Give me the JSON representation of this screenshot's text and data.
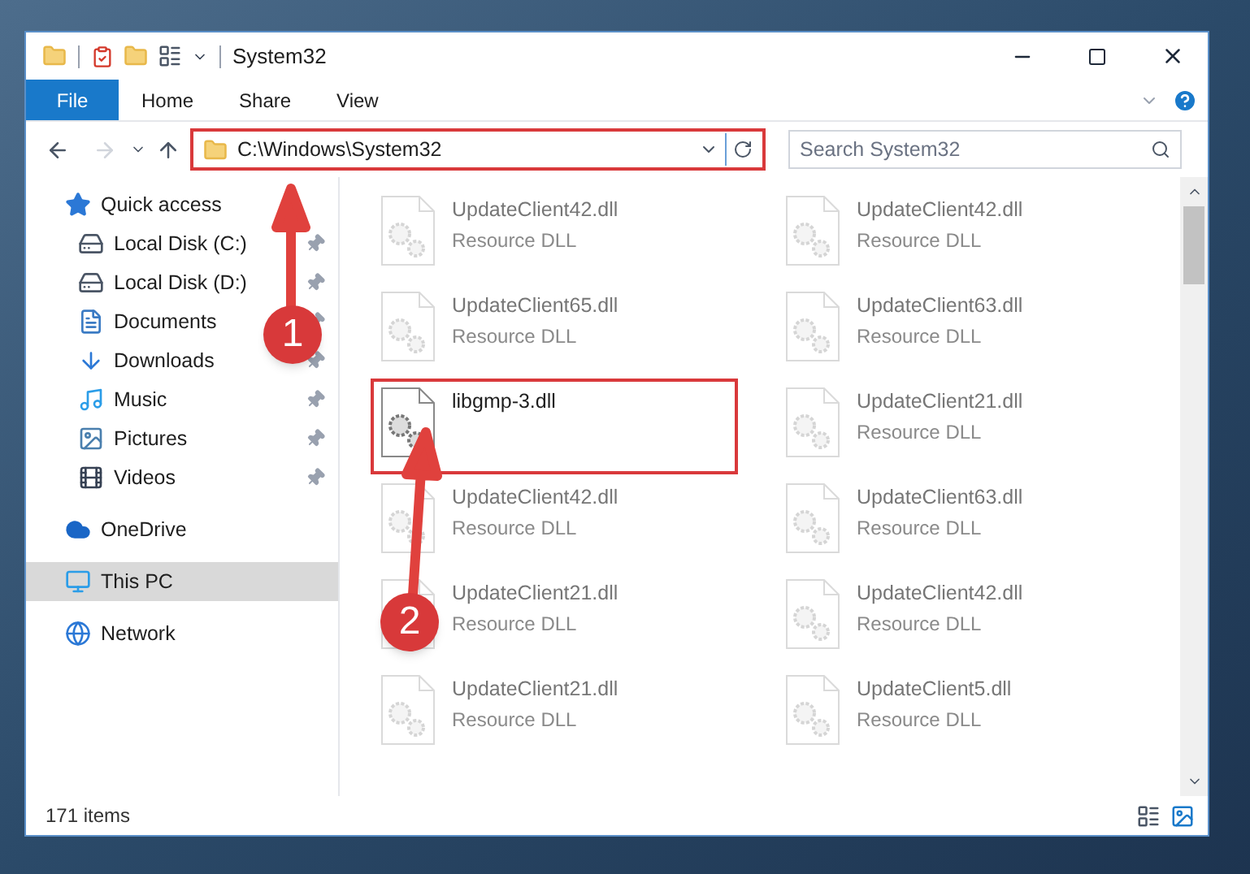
{
  "window": {
    "title": "System32"
  },
  "ribbon_tabs": [
    {
      "label": "File",
      "selected": true
    },
    {
      "label": "Home",
      "selected": false
    },
    {
      "label": "Share",
      "selected": false
    },
    {
      "label": "View",
      "selected": false
    }
  ],
  "address": {
    "path": "C:\\Windows\\System32",
    "highlighted": true
  },
  "search": {
    "placeholder": "Search System32"
  },
  "sidebar": {
    "items": [
      {
        "label": "Quick access",
        "kind": "star",
        "selected": false,
        "children": [
          {
            "label": "Local Disk (C:)",
            "kind": "drive",
            "pinned": true,
            "selected": false
          },
          {
            "label": "Local Disk (D:)",
            "kind": "drive",
            "pinned": true,
            "selected": false
          },
          {
            "label": "Documents",
            "kind": "documents",
            "pinned": true,
            "selected": false
          },
          {
            "label": "Downloads",
            "kind": "downloads",
            "pinned": true,
            "selected": false
          },
          {
            "label": "Music",
            "kind": "music",
            "pinned": true,
            "selected": false
          },
          {
            "label": "Pictures",
            "kind": "pictures",
            "pinned": true,
            "selected": false
          },
          {
            "label": "Videos",
            "kind": "videos",
            "pinned": true,
            "selected": false
          }
        ]
      },
      {
        "label": "OneDrive",
        "kind": "cloud",
        "selected": false
      },
      {
        "label": "This PC",
        "kind": "computer",
        "selected": true
      },
      {
        "label": "Network",
        "kind": "network",
        "selected": false
      }
    ]
  },
  "files": [
    {
      "name": "UpdateClient42.dll",
      "type": "Resource DLL",
      "blurred": true,
      "highlighted": false
    },
    {
      "name": "UpdateClient42.dll",
      "type": "Resource DLL",
      "blurred": true,
      "highlighted": false
    },
    {
      "name": "UpdateClient65.dll",
      "type": "Resource DLL",
      "blurred": true,
      "highlighted": false
    },
    {
      "name": "UpdateClient63.dll",
      "type": "Resource DLL",
      "blurred": true,
      "highlighted": false
    },
    {
      "name": "libgmp-3.dll",
      "blurred": false,
      "highlighted": true
    },
    {
      "name": "UpdateClient21.dll",
      "type": "Resource DLL",
      "blurred": true,
      "highlighted": false
    },
    {
      "name": "UpdateClient42.dll",
      "type": "Resource DLL",
      "blurred": true,
      "highlighted": false
    },
    {
      "name": "UpdateClient63.dll",
      "type": "Resource DLL",
      "blurred": true,
      "highlighted": false
    },
    {
      "name": "UpdateClient21.dll",
      "type": "Resource DLL",
      "blurred": true,
      "highlighted": false
    },
    {
      "name": "UpdateClient42.dll",
      "type": "Resource DLL",
      "blurred": true,
      "highlighted": false
    },
    {
      "name": "UpdateClient21.dll",
      "type": "Resource DLL",
      "blurred": true,
      "highlighted": false
    },
    {
      "name": "UpdateClient5.dll",
      "type": "Resource DLL",
      "blurred": true,
      "highlighted": false
    }
  ],
  "annotations": [
    {
      "number": "1"
    },
    {
      "number": "2"
    }
  ],
  "status_bar": {
    "item_count": "171 items"
  }
}
